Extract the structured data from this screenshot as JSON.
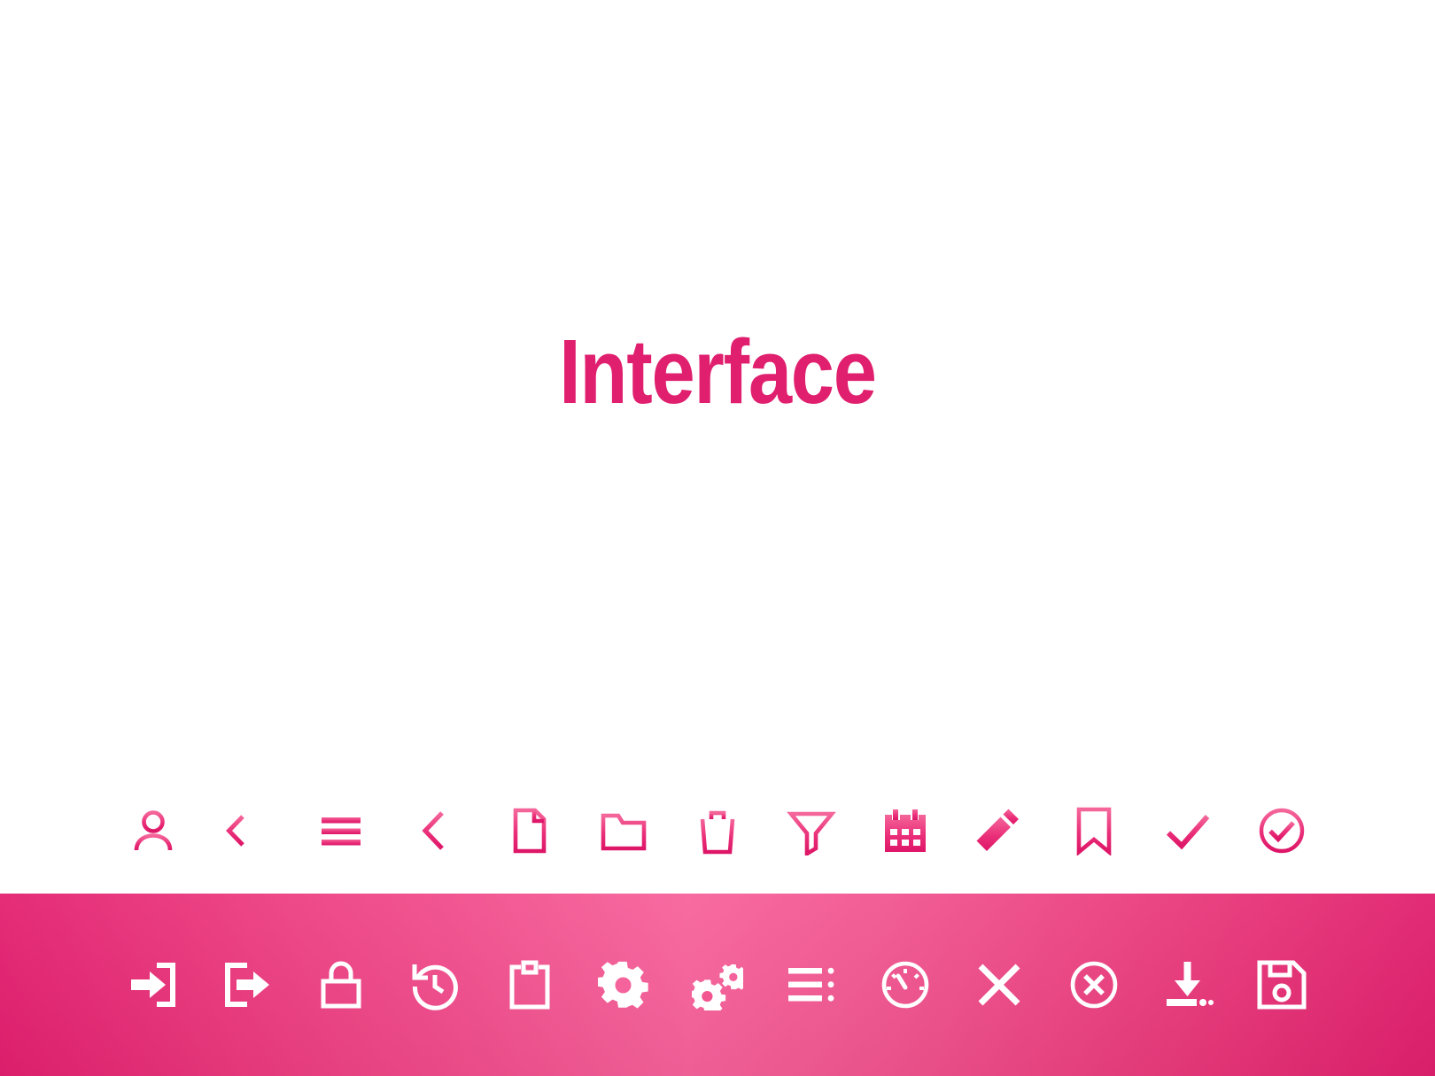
{
  "page": {
    "title": "Interface",
    "background_color": "#ffffff",
    "accent_color": "#e0206f",
    "band_color_light": "#f7629b",
    "band_color_dark": "#e31f6f",
    "icon_color_light": "#f4548f",
    "icon_color_dark": "#e0206f",
    "band_icon_color": "#ffffff"
  },
  "icon_rows": [
    {
      "id": "row-outline-pink",
      "style": "pink-on-white",
      "icons": [
        {
          "name": "user-icon",
          "label": "User"
        },
        {
          "name": "arrow-left-icon",
          "label": "Arrow Left"
        },
        {
          "name": "menu-icon",
          "label": "Menu"
        },
        {
          "name": "chevron-left-icon",
          "label": "Chevron Left"
        },
        {
          "name": "file-icon",
          "label": "File"
        },
        {
          "name": "folder-icon",
          "label": "Folder"
        },
        {
          "name": "trash-icon",
          "label": "Trash"
        },
        {
          "name": "filter-icon",
          "label": "Filter"
        },
        {
          "name": "calendar-icon",
          "label": "Calendar"
        },
        {
          "name": "pencil-icon",
          "label": "Edit"
        },
        {
          "name": "bookmark-icon",
          "label": "Bookmark"
        },
        {
          "name": "check-icon",
          "label": "Check"
        },
        {
          "name": "check-circle-icon",
          "label": "Check Circle"
        }
      ]
    },
    {
      "id": "row-white-on-pink",
      "style": "white-on-pink",
      "icons": [
        {
          "name": "login-icon",
          "label": "Login"
        },
        {
          "name": "logout-icon",
          "label": "Logout"
        },
        {
          "name": "lock-icon",
          "label": "Lock"
        },
        {
          "name": "history-icon",
          "label": "History"
        },
        {
          "name": "clipboard-icon",
          "label": "Clipboard"
        },
        {
          "name": "gear-icon",
          "label": "Settings"
        },
        {
          "name": "gears-icon",
          "label": "Preferences"
        },
        {
          "name": "list-icon",
          "label": "List"
        },
        {
          "name": "gauge-icon",
          "label": "Dashboard"
        },
        {
          "name": "close-icon",
          "label": "Close"
        },
        {
          "name": "close-circle-icon",
          "label": "Cancel"
        },
        {
          "name": "download-icon",
          "label": "Download"
        },
        {
          "name": "save-icon",
          "label": "Save"
        }
      ]
    }
  ]
}
